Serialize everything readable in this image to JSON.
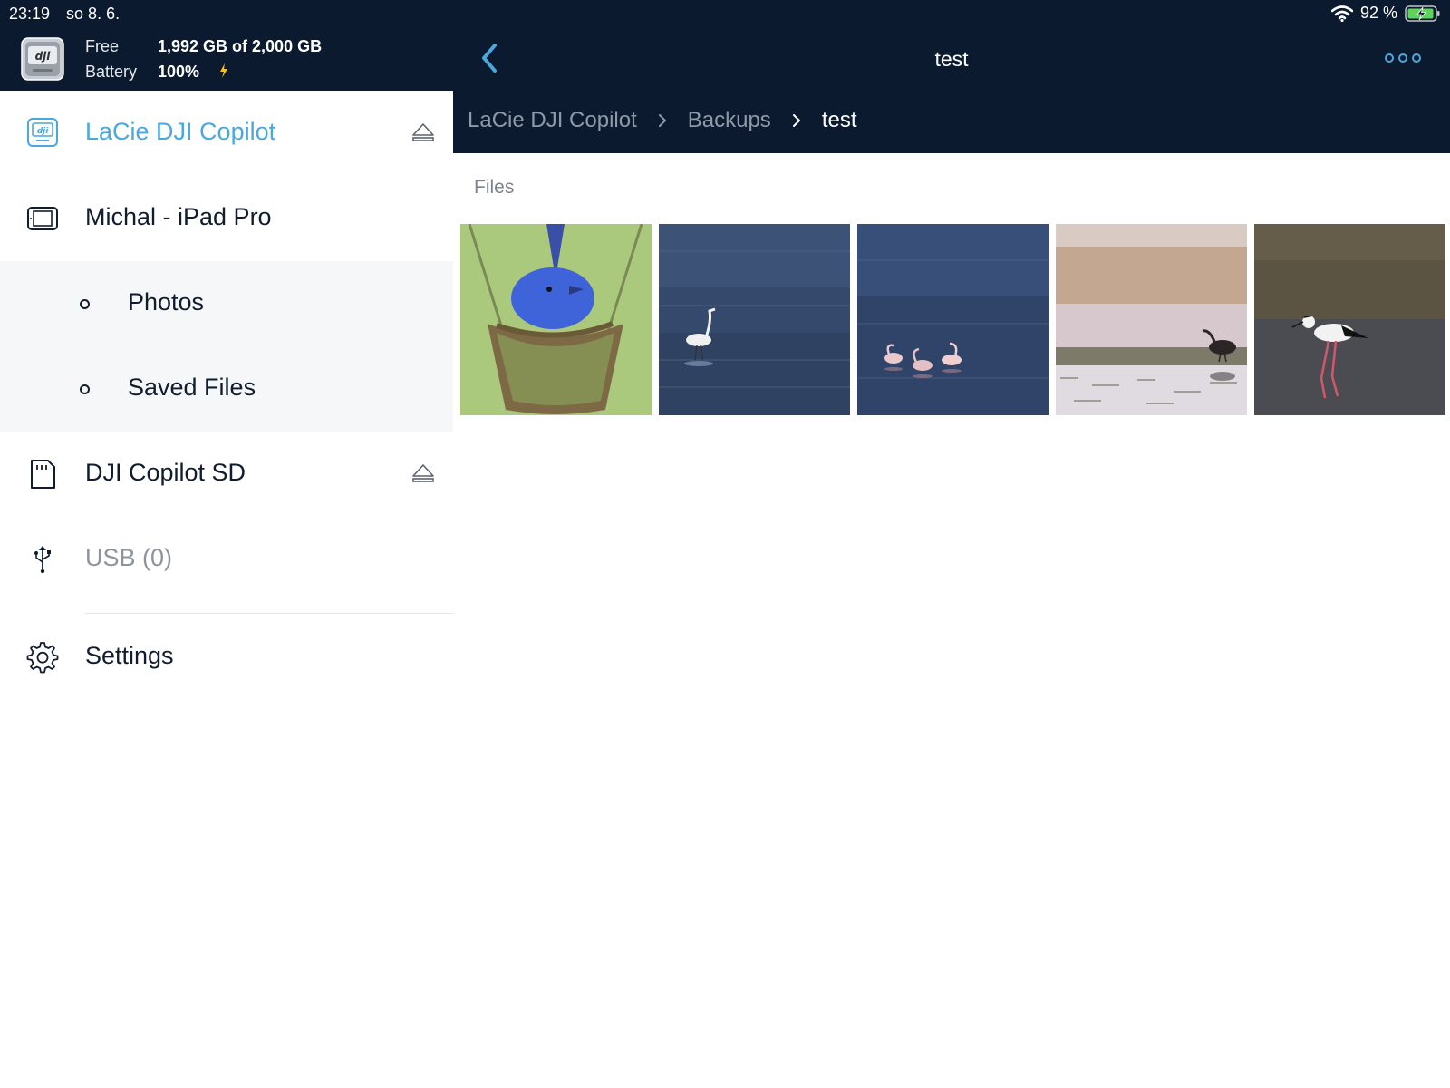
{
  "status_bar": {
    "time": "23:19",
    "date": "so 8. 6.",
    "battery_percent": "92 %",
    "icons": [
      "wifi-icon",
      "battery-charging-icon"
    ]
  },
  "device_header": {
    "free_label": "Free",
    "free_value": "1,992 GB of 2,000 GB",
    "battery_label": "Battery",
    "battery_value": "100%",
    "charging_icon": "lightning-bolt-icon",
    "device_icon": "dji-drive-icon"
  },
  "nav": {
    "title": "test",
    "back_icon": "chevron-left-icon",
    "more_icon": "more-horizontal-icon",
    "breadcrumb": [
      {
        "label": "LaCie DJI Copilot"
      },
      {
        "label": "Backups"
      },
      {
        "label": "test"
      }
    ]
  },
  "sidebar": {
    "items": [
      {
        "label": "LaCie DJI Copilot",
        "icon": "dji-drive-icon",
        "active": true,
        "ejectable": true
      },
      {
        "label": "Michal - iPad Pro",
        "icon": "ipad-icon"
      },
      {
        "label": "Photos",
        "sub": true
      },
      {
        "label": "Saved Files",
        "sub": true
      },
      {
        "label": "DJI Copilot SD",
        "icon": "sd-card-icon",
        "ejectable": true
      },
      {
        "label": "USB (0)",
        "icon": "usb-icon",
        "disabled": true
      },
      {
        "label": "Settings",
        "icon": "gear-icon"
      }
    ]
  },
  "content": {
    "section_title": "Files",
    "files": [
      {
        "subject": "blue bird in nest"
      },
      {
        "subject": "white egret in water"
      },
      {
        "subject": "flamingos in water"
      },
      {
        "subject": "ibis on shore"
      },
      {
        "subject": "black-winged stilt"
      }
    ]
  },
  "colors": {
    "header_bg": "#0b1a2e",
    "accent": "#4aa8dc",
    "sidebar_text": "#111d2e",
    "sub_bg": "#f6f7f8",
    "muted": "#8e949b"
  }
}
